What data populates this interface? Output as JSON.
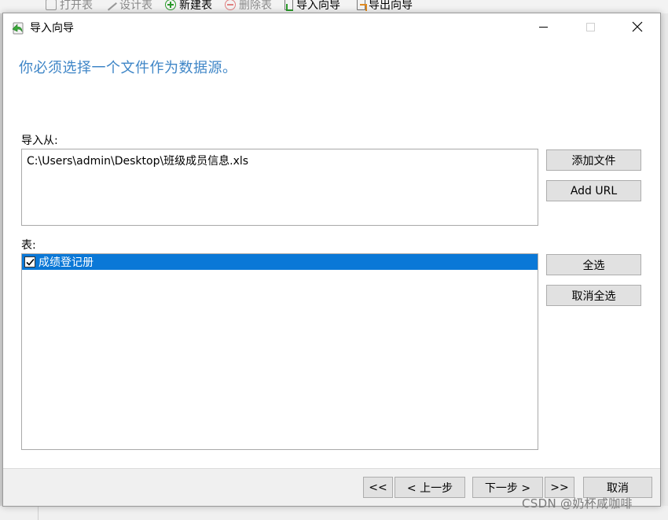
{
  "background_toolbar": {
    "items": [
      {
        "label": "打开表",
        "icon": "folder-icon",
        "enabled": false
      },
      {
        "label": "设计表",
        "icon": "pencil-icon",
        "enabled": false
      },
      {
        "label": "新建表",
        "icon": "plus-circle-icon",
        "enabled": true
      },
      {
        "label": "删除表",
        "icon": "minus-circle-icon",
        "enabled": false
      },
      {
        "label": "导入向导",
        "icon": "import-icon",
        "enabled": true
      },
      {
        "label": "导出向导",
        "icon": "export-icon",
        "enabled": true
      }
    ]
  },
  "dialog": {
    "title": "导入向导",
    "title_icon": "import-wizard-icon",
    "heading": "你必须选择一个文件作为数据源。",
    "import_from": {
      "label": "导入从:",
      "files": [
        "C:\\Users\\admin\\Desktop\\班级成员信息.xls"
      ],
      "add_file_label": "添加文件",
      "add_url_label": "Add URL"
    },
    "tables": {
      "label": "表:",
      "rows": [
        {
          "name": "成绩登记册",
          "checked": true,
          "selected": true
        }
      ],
      "select_all_label": "全选",
      "deselect_all_label": "取消全选"
    },
    "footer": {
      "first_label": "<<",
      "prev_label": "< 上一步",
      "next_label": "下一步 >",
      "last_label": ">>",
      "cancel_label": "取消"
    }
  },
  "watermark": "CSDN @奶杯咸咖啡",
  "colors": {
    "heading": "#3f86c7",
    "selection": "#0a78d7",
    "button_face": "#e1e1e1",
    "footer_bg": "#f0f0f0"
  }
}
